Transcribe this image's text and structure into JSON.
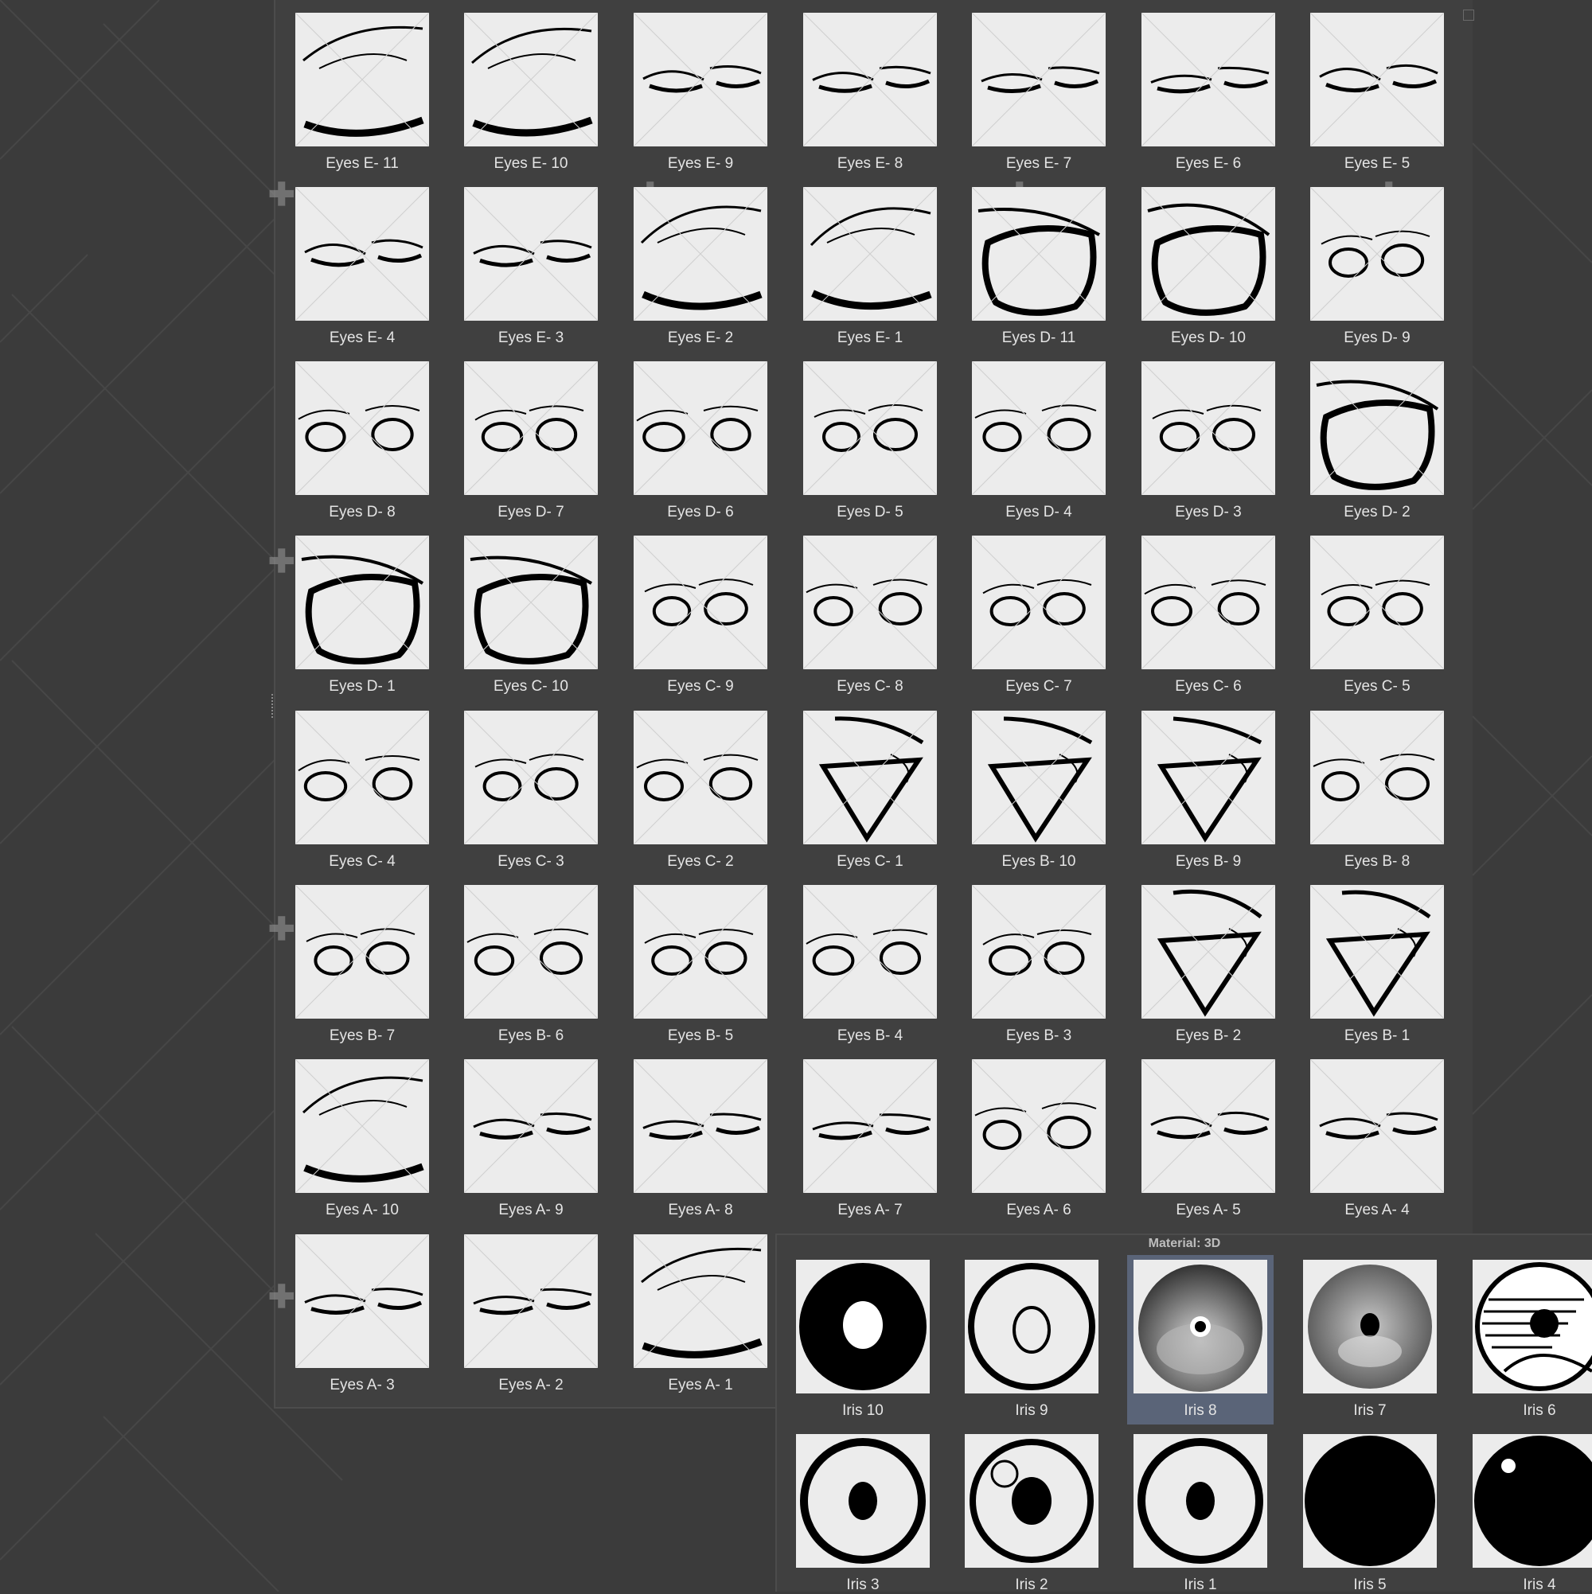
{
  "eyes_panel": {
    "items": [
      {
        "label": "Eyes E- 11",
        "shape": "lid"
      },
      {
        "label": "Eyes E- 10",
        "shape": "lid"
      },
      {
        "label": "Eyes E- 9",
        "shape": "closed"
      },
      {
        "label": "Eyes E- 8",
        "shape": "closed"
      },
      {
        "label": "Eyes E- 7",
        "shape": "closed"
      },
      {
        "label": "Eyes E- 6",
        "shape": "closed"
      },
      {
        "label": "Eyes E- 5",
        "shape": "closed"
      },
      {
        "label": "Eyes E- 4",
        "shape": "closed"
      },
      {
        "label": "Eyes E- 3",
        "shape": "closed"
      },
      {
        "label": "Eyes E- 2",
        "shape": "lid"
      },
      {
        "label": "Eyes E- 1",
        "shape": "lid"
      },
      {
        "label": "Eyes D- 11",
        "shape": "big"
      },
      {
        "label": "Eyes D- 10",
        "shape": "big"
      },
      {
        "label": "Eyes D- 9",
        "shape": "pair"
      },
      {
        "label": "Eyes D- 8",
        "shape": "pair"
      },
      {
        "label": "Eyes D- 7",
        "shape": "pair"
      },
      {
        "label": "Eyes D- 6",
        "shape": "pair"
      },
      {
        "label": "Eyes D- 5",
        "shape": "pair"
      },
      {
        "label": "Eyes D- 4",
        "shape": "pair"
      },
      {
        "label": "Eyes D- 3",
        "shape": "pair"
      },
      {
        "label": "Eyes D- 2",
        "shape": "big"
      },
      {
        "label": "Eyes D- 1",
        "shape": "big"
      },
      {
        "label": "Eyes C- 10",
        "shape": "big"
      },
      {
        "label": "Eyes C- 9",
        "shape": "pair"
      },
      {
        "label": "Eyes C- 8",
        "shape": "pair"
      },
      {
        "label": "Eyes C- 7",
        "shape": "pair"
      },
      {
        "label": "Eyes C- 6",
        "shape": "pair"
      },
      {
        "label": "Eyes C- 5",
        "shape": "pair"
      },
      {
        "label": "Eyes C- 4",
        "shape": "pair"
      },
      {
        "label": "Eyes C- 3",
        "shape": "pair"
      },
      {
        "label": "Eyes C- 2",
        "shape": "pair"
      },
      {
        "label": "Eyes C- 1",
        "shape": "tri"
      },
      {
        "label": "Eyes B- 10",
        "shape": "tri"
      },
      {
        "label": "Eyes B- 9",
        "shape": "tri"
      },
      {
        "label": "Eyes B- 8",
        "shape": "pair"
      },
      {
        "label": "Eyes B- 7",
        "shape": "pair"
      },
      {
        "label": "Eyes B- 6",
        "shape": "pair"
      },
      {
        "label": "Eyes B- 5",
        "shape": "pair"
      },
      {
        "label": "Eyes B- 4",
        "shape": "pair"
      },
      {
        "label": "Eyes B- 3",
        "shape": "pair"
      },
      {
        "label": "Eyes B- 2",
        "shape": "tri"
      },
      {
        "label": "Eyes B- 1",
        "shape": "tri"
      },
      {
        "label": "Eyes A- 10",
        "shape": "lid"
      },
      {
        "label": "Eyes A- 9",
        "shape": "closed"
      },
      {
        "label": "Eyes A- 8",
        "shape": "closed"
      },
      {
        "label": "Eyes A- 7",
        "shape": "closed"
      },
      {
        "label": "Eyes A- 6",
        "shape": "pair"
      },
      {
        "label": "Eyes A- 5",
        "shape": "closed"
      },
      {
        "label": "Eyes A- 4",
        "shape": "closed"
      },
      {
        "label": "Eyes A- 3",
        "shape": "closed"
      },
      {
        "label": "Eyes A- 2",
        "shape": "closed"
      },
      {
        "label": "Eyes A- 1",
        "shape": "lid"
      }
    ]
  },
  "iris_panel": {
    "title": "Material: 3D",
    "selected": "Iris 8",
    "items": [
      {
        "label": "Iris 10",
        "style": "solid-ring"
      },
      {
        "label": "Iris 9",
        "style": "ring-small"
      },
      {
        "label": "Iris 8",
        "style": "photo"
      },
      {
        "label": "Iris 7",
        "style": "photo-gray"
      },
      {
        "label": "Iris 6",
        "style": "sketch"
      },
      {
        "label": "Iris 3",
        "style": "ring-pupil"
      },
      {
        "label": "Iris 2",
        "style": "ring-highlight"
      },
      {
        "label": "Iris 1",
        "style": "ring-pupil"
      },
      {
        "label": "Iris 5",
        "style": "solid"
      },
      {
        "label": "Iris 4",
        "style": "solid-highlight"
      }
    ]
  }
}
